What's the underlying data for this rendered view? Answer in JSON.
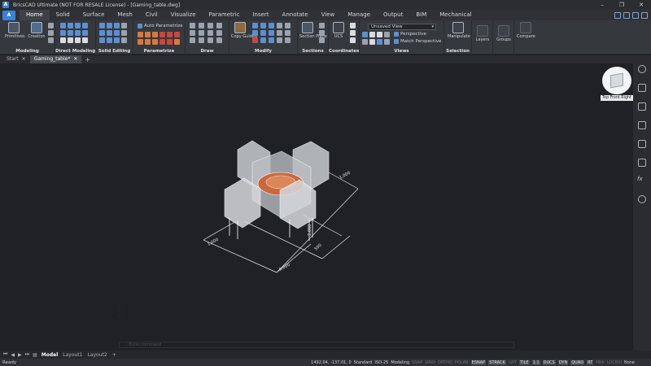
{
  "window": {
    "title": "BricsCAD Ultimate (NOT FOR RESALE License) - [Gaming_table.dwg]",
    "app_logo": "A",
    "minimize": "–",
    "restore": "❐",
    "close": "✕"
  },
  "ribbon_tabs": [
    "Home",
    "Solid",
    "Surface",
    "Mesh",
    "Civil",
    "Visualize",
    "Parametric",
    "Insert",
    "Annotate",
    "View",
    "Manage",
    "Output",
    "BIM",
    "Mechanical"
  ],
  "ribbon": {
    "modeling": {
      "title": "Modeling",
      "primitives": "Primitives",
      "creation": "Creation"
    },
    "direct_modeling": {
      "title": "Direct Modeling"
    },
    "solid_editing": {
      "title": "Solid Editing"
    },
    "parametrize": {
      "title": "Parametrize",
      "auto": "Auto Parametrize"
    },
    "draw": {
      "title": "Draw"
    },
    "modify": {
      "title": "Modify",
      "copy_guided": "Copy Guided"
    },
    "sections": {
      "title": "Sections",
      "section_plane": "Section Plane"
    },
    "coordinates": {
      "title": "Coordinates",
      "ucs": "UCS"
    },
    "views": {
      "title": "Views",
      "combo_value": "Unsaved View",
      "perspective": "Perspective",
      "match_perspective": "Match Perspective"
    },
    "selection": {
      "title": "Selection",
      "manipulate": "Manipulate"
    },
    "layers": {
      "title": "Layers"
    },
    "groups": {
      "title": "Groups"
    },
    "compare": {
      "title": "Compare"
    }
  },
  "doc_tabs": [
    {
      "label": "Start"
    },
    {
      "label": "Gaming_table*"
    }
  ],
  "doc_tab_close": "✕",
  "doc_tab_add": "+",
  "viewcube": {
    "label": "Top Front Right"
  },
  "drawing": {
    "dims": [
      "1,000",
      "1,000",
      "5,000",
      "500",
      "2,000"
    ]
  },
  "command_line": {
    "history": [
      "::",
      "::",
      "::",
      "::"
    ],
    "prompt": ": Enter command"
  },
  "layout_tabs": [
    "Model",
    "Layout1",
    "Layout2"
  ],
  "layout_add": "+",
  "status": {
    "ready": "Ready",
    "coords": "1492.04, -137.01, 0",
    "style": "Standard",
    "dimstyle": "ISO-25",
    "workspace": "Modeling",
    "toggles": [
      {
        "label": "SNAP",
        "on": false
      },
      {
        "label": "GRID",
        "on": false
      },
      {
        "label": "ORTHO",
        "on": false
      },
      {
        "label": "POLAR",
        "on": false
      },
      {
        "label": "ESNAP",
        "on": true
      },
      {
        "label": "STRACK",
        "on": true
      },
      {
        "label": "LWT",
        "on": false
      },
      {
        "label": "TILE",
        "on": true
      },
      {
        "label": "1:1",
        "on": true
      },
      {
        "label": "DUCS",
        "on": true
      },
      {
        "label": "DYN",
        "on": true
      },
      {
        "label": "QUAD",
        "on": true
      },
      {
        "label": "RT",
        "on": true
      },
      {
        "label": "HKA",
        "on": false
      },
      {
        "label": "LOCKUI",
        "on": false
      }
    ],
    "none": "None"
  },
  "colors": {
    "accent": "#3a82d6",
    "table_top": "#c9673e",
    "solids": "#d7d9dc"
  }
}
